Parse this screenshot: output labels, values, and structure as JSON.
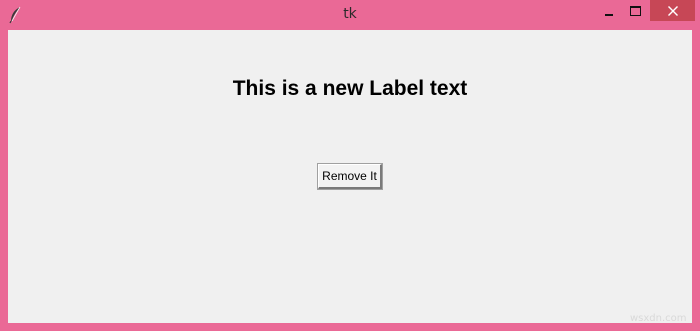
{
  "window": {
    "title": "tk",
    "frame_color": "#ea6996",
    "close_button_color": "#c74756"
  },
  "main": {
    "label_text": "This is a new Label text",
    "button_label": "Remove It"
  },
  "watermark": "wsxdn.com",
  "icons": {
    "app": "feather-icon",
    "minimize": "minimize-icon",
    "maximize": "maximize-icon",
    "close": "close-icon"
  }
}
